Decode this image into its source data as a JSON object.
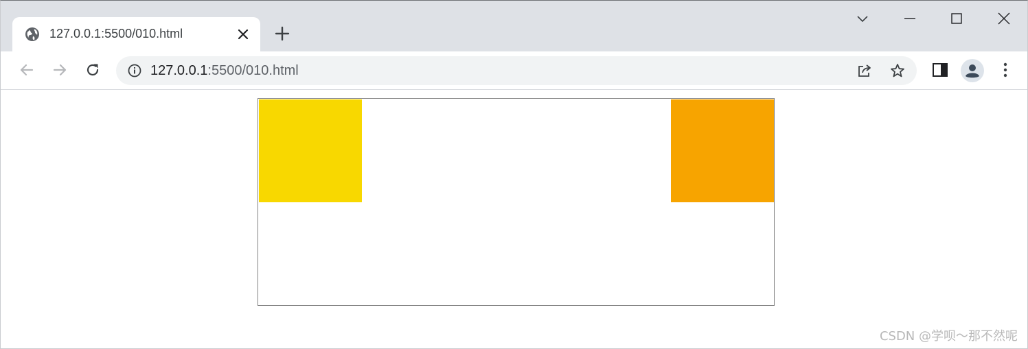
{
  "tab": {
    "title": "127.0.0.1:5500/010.html"
  },
  "omnibox": {
    "url_host": "127.0.0.1",
    "url_rest": ":5500/010.html"
  },
  "page": {
    "left_box_color": "#f8d800",
    "right_box_color": "#f7a400"
  },
  "watermark": {
    "text": "CSDN @学呗～那不然呢"
  },
  "icons": {
    "favicon": "globe-icon",
    "tab_close": "close-icon",
    "new_tab": "plus-icon",
    "tab_search": "chevron-down-icon",
    "minimize": "minimize-icon",
    "maximize": "maximize-icon",
    "close_window": "close-icon",
    "back": "arrow-left-icon",
    "forward": "arrow-right-icon",
    "reload": "reload-icon",
    "site_info": "info-icon",
    "share": "share-icon",
    "bookmark": "star-icon",
    "side_panel": "side-panel-icon",
    "profile": "avatar-icon",
    "menu": "kebab-menu-icon"
  }
}
